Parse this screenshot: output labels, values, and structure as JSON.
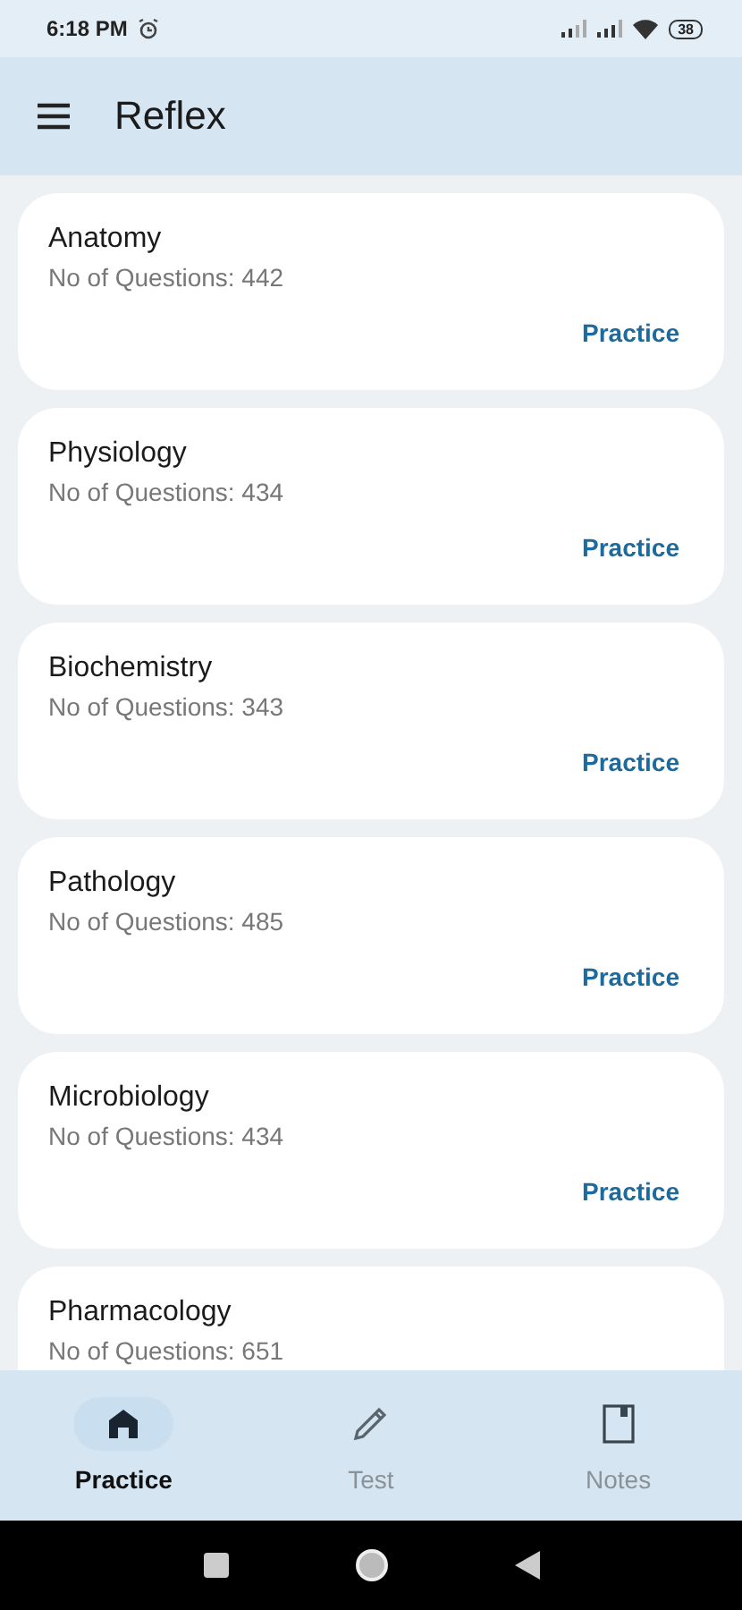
{
  "status_bar": {
    "time": "6:18 PM",
    "battery": "38"
  },
  "app_bar": {
    "title": "Reflex"
  },
  "subjects": [
    {
      "name": "Anatomy",
      "count": "No of Questions: 442",
      "action": "Practice"
    },
    {
      "name": "Physiology",
      "count": "No of Questions: 434",
      "action": "Practice"
    },
    {
      "name": "Biochemistry",
      "count": "No of Questions: 343",
      "action": "Practice"
    },
    {
      "name": "Pathology",
      "count": "No of Questions: 485",
      "action": "Practice"
    },
    {
      "name": "Microbiology",
      "count": "No of Questions: 434",
      "action": "Practice"
    },
    {
      "name": "Pharmacology",
      "count": "No of Questions: 651"
    }
  ],
  "bottom_nav": [
    {
      "label": "Practice",
      "kind": "home",
      "selected": true
    },
    {
      "label": "Test",
      "kind": "pencil",
      "selected": false
    },
    {
      "label": "Notes",
      "kind": "notebook",
      "selected": false
    }
  ]
}
